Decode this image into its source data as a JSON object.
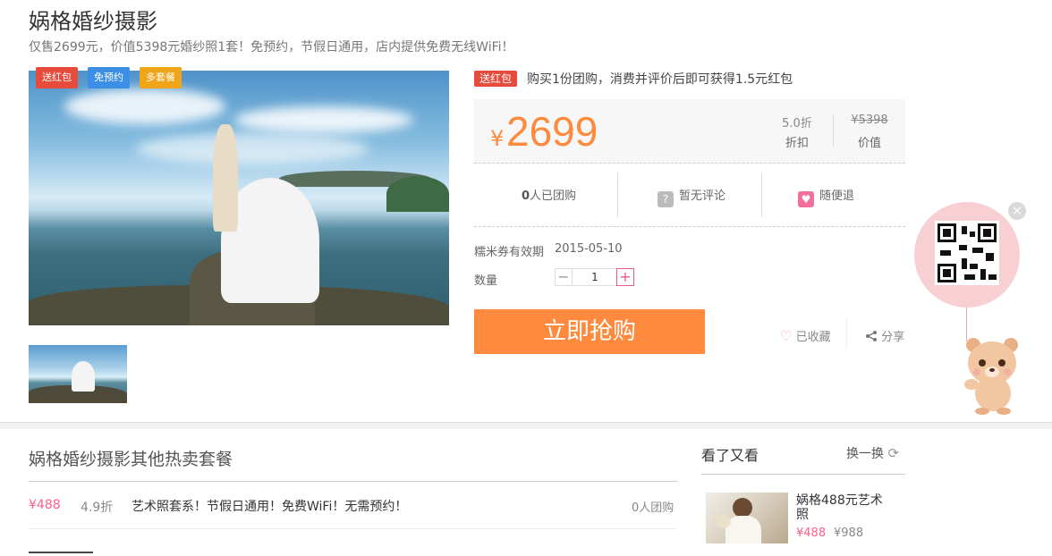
{
  "header": {
    "title": "娲格婚纱摄影",
    "subtitle": "仅售2699元，价值5398元婚纱照1套！免预约，节假日通用，店内提供免费无线WiFi！"
  },
  "gallery": {
    "badges": [
      "送红包",
      "免预约",
      "多套餐"
    ]
  },
  "promo": {
    "tag": "送红包",
    "text": "购买1份团购，消费并评价后即可获得1.5元红包"
  },
  "price": {
    "currency": "¥",
    "current": "2699",
    "discount_value": "5.0折",
    "discount_label": "折扣",
    "original_value": "¥5398",
    "original_label": "价值"
  },
  "stats": {
    "sold_count": "0",
    "sold_suffix": "人已团购",
    "reviews": "暂无评论",
    "refund": "随便退"
  },
  "validity": {
    "label": "糯米券有效期",
    "date": "2015-05-10"
  },
  "quantity": {
    "label": "数量",
    "value": "1",
    "minus": "−",
    "plus": "+"
  },
  "actions": {
    "buy": "立即抢购",
    "favorite": "已收藏",
    "share": "分享"
  },
  "other_packages": {
    "title": "娲格婚纱摄影其他热卖套餐",
    "rows": [
      {
        "price": "¥488",
        "discount": "4.9折",
        "desc": "艺术照套系！节假日通用！免费WiFi！无需预约！",
        "sold": "0人团购"
      }
    ]
  },
  "also_viewed": {
    "title": "看了又看",
    "swap": "换一换",
    "items": [
      {
        "name": "娲格488元艺术照",
        "price": "¥488",
        "original": "¥988"
      }
    ]
  },
  "colors": {
    "accent": "#ff8a3d",
    "pink": "#ff5f8d",
    "red_tag": "#e64b3c"
  }
}
